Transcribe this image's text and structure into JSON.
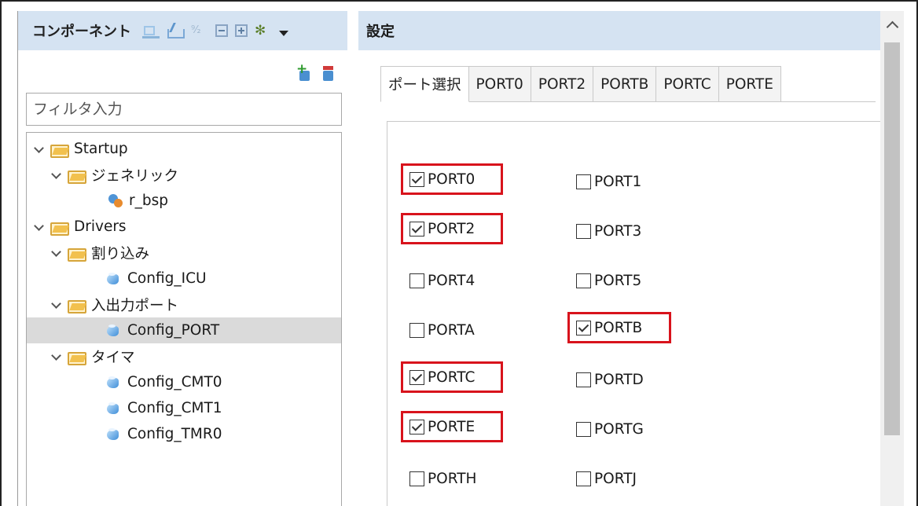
{
  "left_panel": {
    "title": "コンポーネント",
    "filter_placeholder": "フィルタ入力",
    "tree": [
      {
        "label": "Startup",
        "type": "folder",
        "level": 0
      },
      {
        "label": "ジェネリック",
        "type": "folder",
        "level": 1
      },
      {
        "label": "r_bsp",
        "type": "gear",
        "level": 2
      },
      {
        "label": "Drivers",
        "type": "folder",
        "level": 0
      },
      {
        "label": "割り込み",
        "type": "folder",
        "level": 1
      },
      {
        "label": "Config_ICU",
        "type": "component",
        "level": 2
      },
      {
        "label": "入出力ポート",
        "type": "folder",
        "level": 1
      },
      {
        "label": "Config_PORT",
        "type": "component",
        "level": 2,
        "selected": true
      },
      {
        "label": "タイマ",
        "type": "folder",
        "level": 1
      },
      {
        "label": "Config_CMT0",
        "type": "component",
        "level": 2
      },
      {
        "label": "Config_CMT1",
        "type": "component",
        "level": 2
      },
      {
        "label": "Config_TMR0",
        "type": "component",
        "level": 2
      }
    ]
  },
  "right_panel": {
    "title": "設定",
    "tabs": [
      {
        "label": "ポート選択",
        "active": true
      },
      {
        "label": "PORT0"
      },
      {
        "label": "PORT2"
      },
      {
        "label": "PORTB"
      },
      {
        "label": "PORTC"
      },
      {
        "label": "PORTE"
      }
    ],
    "ports": [
      [
        {
          "label": "PORT0",
          "checked": true,
          "highlighted": true
        },
        {
          "label": "PORT1",
          "checked": false
        }
      ],
      [
        {
          "label": "PORT2",
          "checked": true,
          "highlighted": true
        },
        {
          "label": "PORT3",
          "checked": false
        }
      ],
      [
        {
          "label": "PORT4",
          "checked": false
        },
        {
          "label": "PORT5",
          "checked": false
        }
      ],
      [
        {
          "label": "PORTA",
          "checked": false
        },
        {
          "label": "PORTB",
          "checked": true,
          "highlighted": true
        }
      ],
      [
        {
          "label": "PORTC",
          "checked": true,
          "highlighted": true
        },
        {
          "label": "PORTD",
          "checked": false
        }
      ],
      [
        {
          "label": "PORTE",
          "checked": true,
          "highlighted": true
        },
        {
          "label": "PORTG",
          "checked": false
        }
      ],
      [
        {
          "label": "PORTH",
          "checked": false
        },
        {
          "label": "PORTJ",
          "checked": false
        }
      ]
    ]
  },
  "colors": {
    "header_bg": "#d5e3f2",
    "highlight": "#d8131c",
    "selected_row": "#dadada"
  }
}
